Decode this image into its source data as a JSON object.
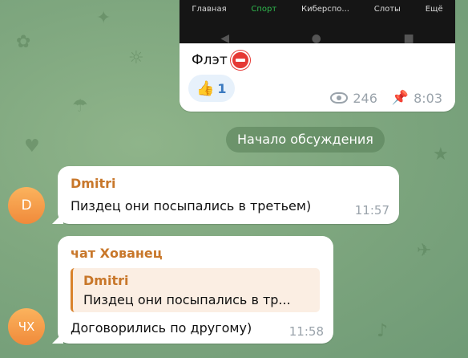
{
  "post": {
    "nav_items": [
      "Главная",
      "Спорт",
      "Киберспо...",
      "Слоты",
      "Ещё"
    ],
    "caption": "Флэт",
    "reaction": {
      "emoji": "👍",
      "count": "1"
    },
    "views": "246",
    "time": "8:03"
  },
  "service_message": "Начало обсуждения",
  "messages": [
    {
      "sender": "Dmitri",
      "avatar_initials": "D",
      "text": "Пиздец они посыпались в третьем)",
      "time": "11:57"
    },
    {
      "sender": "чат Хованец",
      "avatar_initials": "ЧХ",
      "reply": {
        "name": "Dmitri",
        "text": "Пиздец они посыпались в тр..."
      },
      "text": "Договорились по другому)",
      "time": "11:58"
    }
  ],
  "colors": {
    "accent_name": "#c8772a",
    "avatar": "#f08a3b",
    "nav_active": "#2fb94e"
  }
}
